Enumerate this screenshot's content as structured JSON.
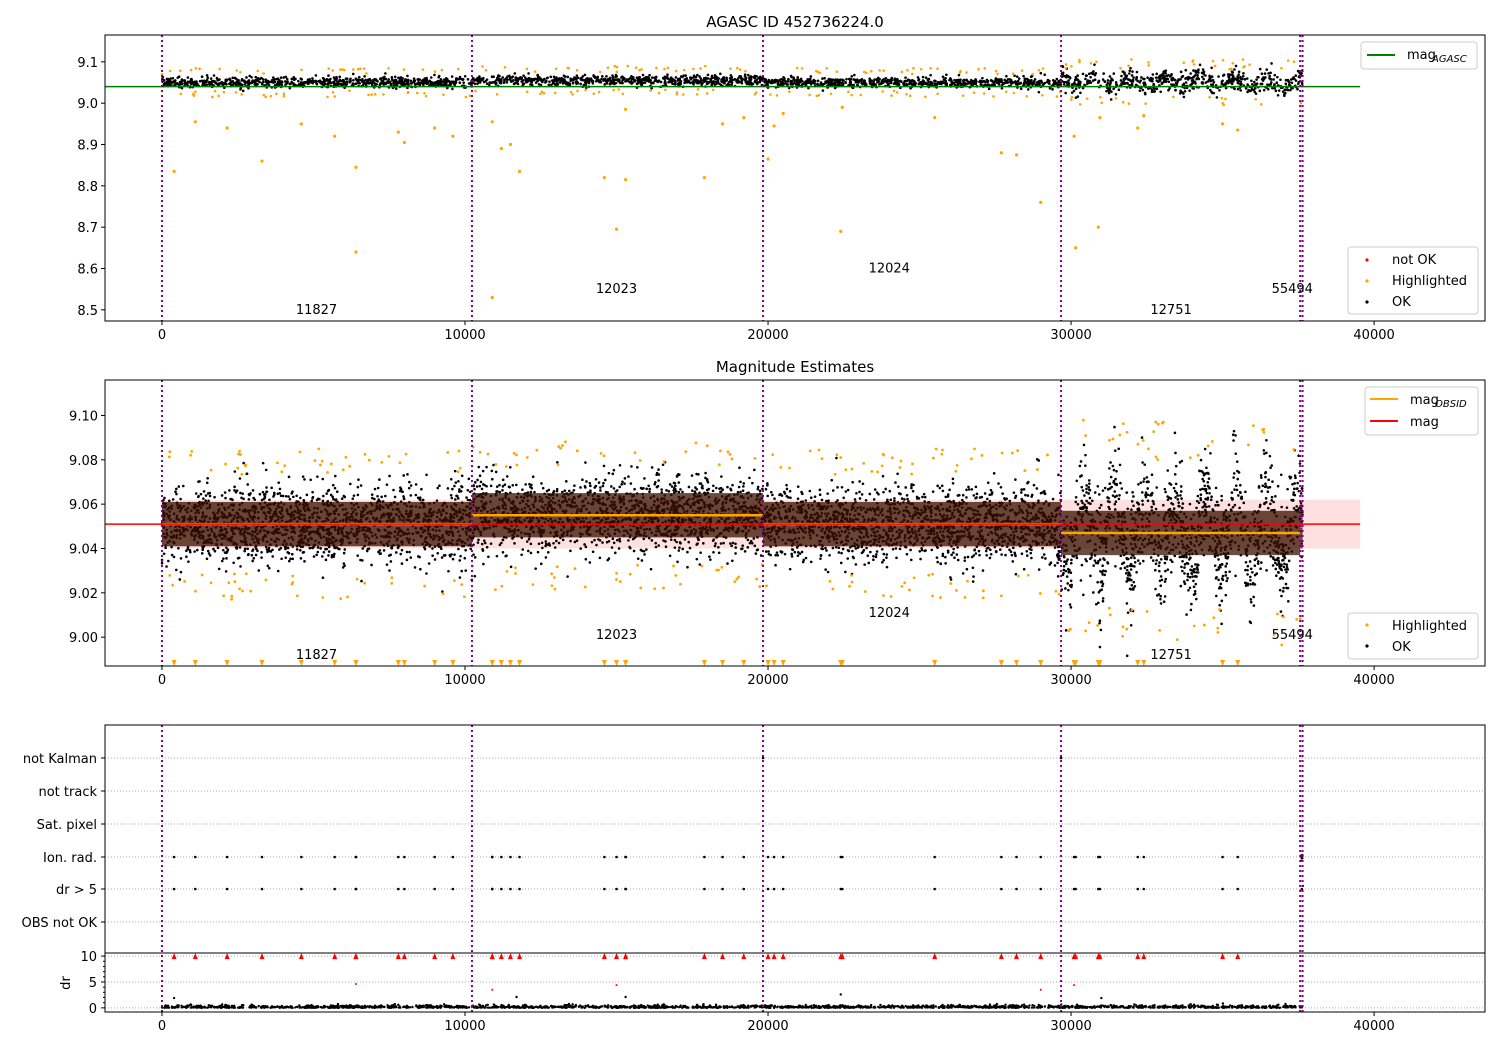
{
  "colors": {
    "ok": "#000000",
    "highlighted": "#ffa500",
    "not_ok": "#ff0000",
    "obsid_line": "#800080",
    "agasc": "#008000",
    "mag": "#ff0000",
    "mag_obsid": "#ffa500",
    "band": "#ffcccc",
    "segment_band": "#3a1000"
  },
  "chart_data": [
    {
      "type": "scatter",
      "title": "AGASC ID 452736224.0",
      "xlim": [
        -1880,
        43660
      ],
      "ylim": [
        8.473,
        9.165
      ],
      "xticks": [
        0,
        10000,
        20000,
        30000,
        40000
      ],
      "yticks": [
        8.5,
        8.6,
        8.7,
        8.8,
        8.9,
        9.0,
        9.1
      ],
      "ytick_labels": [
        "8.5",
        "8.6",
        "8.7",
        "8.8",
        "8.9",
        "9.0",
        "9.1"
      ],
      "legend_top": {
        "position": "upper right",
        "entries": [
          {
            "label": "mag",
            "sub": "AGASC"
          }
        ]
      },
      "legend_bottom": {
        "position": "lower right",
        "entries": [
          "not OK",
          "Highlighted",
          "OK"
        ]
      },
      "mag_agasc": 9.04
    },
    {
      "type": "scatter",
      "title": "Magnitude Estimates",
      "xlim": [
        -1880,
        43660
      ],
      "ylim": [
        8.987,
        9.116
      ],
      "xticks": [
        0,
        10000,
        20000,
        30000,
        40000
      ],
      "yticks": [
        9.0,
        9.02,
        9.04,
        9.06,
        9.08,
        9.1
      ],
      "ytick_labels": [
        "9.00",
        "9.02",
        "9.04",
        "9.06",
        "9.08",
        "9.10"
      ],
      "legend_top": {
        "position": "upper right",
        "entries": [
          {
            "label": "mag",
            "sub": "OBSID"
          },
          {
            "label": "mag",
            "sub": ""
          }
        ]
      },
      "legend_bottom": {
        "position": "lower right",
        "entries": [
          "Highlighted",
          "OK"
        ]
      },
      "mag": 9.051,
      "mag_err_band": [
        9.04,
        9.062
      ]
    },
    {
      "type": "scatter",
      "title": "",
      "xlim": [
        -1880,
        43660
      ],
      "flag_labels": [
        "not Kalman",
        "not track",
        "Sat. pixel",
        "Ion. rad.",
        "dr > 5",
        "OBS not OK"
      ],
      "dr_ylabel": "dr",
      "dr_yticks": [
        0,
        5,
        10
      ],
      "dr_ytick_labels": [
        "0",
        "5",
        "10"
      ],
      "dr_ylim": [
        -0.8,
        10.6
      ]
    }
  ],
  "segments": [
    {
      "obsid": "11827",
      "start": 0,
      "end": 10230,
      "mag_obsid": 9.051,
      "sd": 0.0085,
      "label_x": 5100,
      "label_y1": 8.5,
      "label_y2": 8.992
    },
    {
      "obsid": "12023",
      "start": 10230,
      "end": 19835,
      "mag_obsid": 9.055,
      "sd": 0.0085,
      "label_x": 15000,
      "label_y1": 8.55,
      "label_y2": 9.001
    },
    {
      "obsid": "12024",
      "start": 19835,
      "end": 29670,
      "mag_obsid": 9.051,
      "sd": 0.0085,
      "label_x": 24000,
      "label_y1": 8.6,
      "label_y2": 9.011
    },
    {
      "obsid": "12751",
      "start": 29670,
      "end": 37560,
      "mag_obsid": 9.047,
      "sd": 0.016,
      "label_x": 33300,
      "label_y1": 8.5,
      "label_y2": 8.992
    },
    {
      "obsid": "55494",
      "start": 37560,
      "end": 37640,
      "mag_obsid": 9.05,
      "sd": 0.01,
      "label_x": 37300,
      "label_y1": 8.55,
      "label_y2": 9.001
    }
  ],
  "outliers": [
    [
      400,
      8.835
    ],
    [
      1100,
      8.955
    ],
    [
      2150,
      8.94
    ],
    [
      3300,
      8.86
    ],
    [
      4600,
      8.95
    ],
    [
      5700,
      8.92
    ],
    [
      6400,
      8.845
    ],
    [
      6400,
      8.64
    ],
    [
      7800,
      8.93
    ],
    [
      8000,
      8.905
    ],
    [
      9000,
      8.94
    ],
    [
      9600,
      8.92
    ],
    [
      10900,
      8.955
    ],
    [
      10900,
      8.53
    ],
    [
      11200,
      8.89
    ],
    [
      11500,
      8.9
    ],
    [
      11800,
      8.835
    ],
    [
      14600,
      8.82
    ],
    [
      15000,
      8.695
    ],
    [
      15300,
      8.815
    ],
    [
      15300,
      8.985
    ],
    [
      17900,
      8.82
    ],
    [
      18500,
      8.95
    ],
    [
      19200,
      8.965
    ],
    [
      20000,
      8.865
    ],
    [
      20200,
      8.945
    ],
    [
      20500,
      8.975
    ],
    [
      22400,
      8.69
    ],
    [
      22450,
      8.99
    ],
    [
      25500,
      8.965
    ],
    [
      27700,
      8.88
    ],
    [
      28200,
      8.875
    ],
    [
      29000,
      8.76
    ],
    [
      30100,
      8.92
    ],
    [
      30150,
      8.65
    ],
    [
      30900,
      8.7
    ],
    [
      30950,
      8.965
    ],
    [
      32200,
      8.94
    ],
    [
      32400,
      8.97
    ],
    [
      35000,
      8.95
    ],
    [
      35500,
      8.935
    ]
  ]
}
